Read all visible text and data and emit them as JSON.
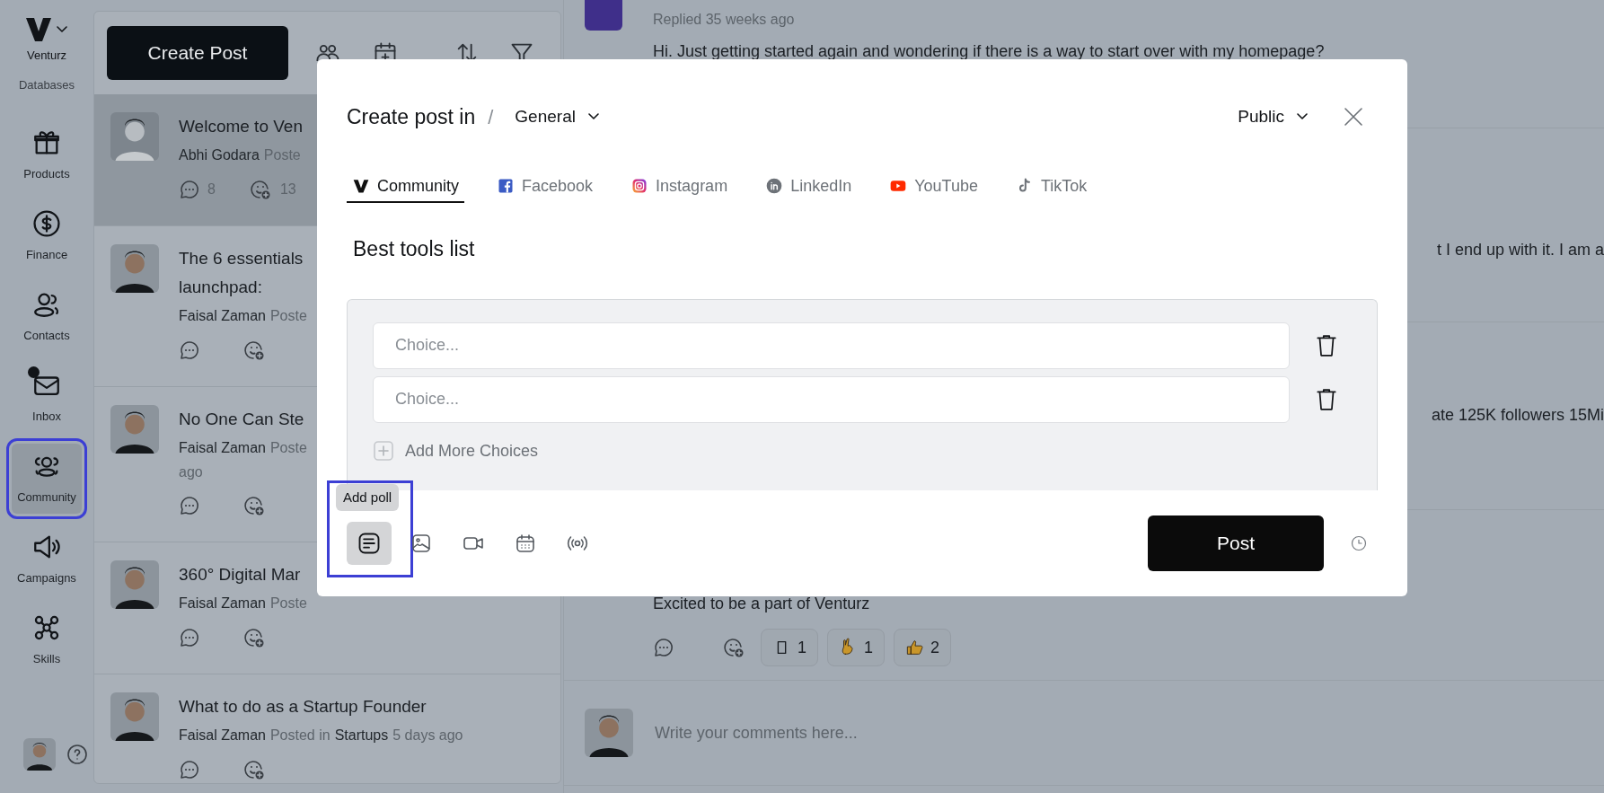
{
  "sidebar": {
    "brand": "Venturz",
    "items": [
      {
        "label": "Databases",
        "selected": false,
        "unread": false,
        "outlined": false
      },
      {
        "label": "Products",
        "selected": false,
        "unread": false,
        "outlined": false
      },
      {
        "label": "Finance",
        "selected": false,
        "unread": false,
        "outlined": false
      },
      {
        "label": "Contacts",
        "selected": false,
        "unread": false,
        "outlined": false
      },
      {
        "label": "Inbox",
        "selected": false,
        "unread": true,
        "outlined": false
      },
      {
        "label": "Community",
        "selected": true,
        "unread": false,
        "outlined": true
      },
      {
        "label": "Campaigns",
        "selected": false,
        "unread": false,
        "outlined": false
      },
      {
        "label": "Skills",
        "selected": false,
        "unread": false,
        "outlined": false
      }
    ]
  },
  "feed": {
    "create_button": "Create Post",
    "posts": [
      {
        "title_lines": [
          "Welcome to Ven"
        ],
        "author": "Abhi Godara",
        "meta_lines": [
          "Poste"
        ],
        "comments": "8",
        "reactions": "13",
        "selected": true
      },
      {
        "title_lines": [
          "The 6 essentials",
          "launchpad:"
        ],
        "author": "Faisal Zaman",
        "meta_lines": [
          "Poste"
        ],
        "selected": false
      },
      {
        "title_lines": [
          "No One Can Ste"
        ],
        "author": "Faisal Zaman",
        "meta_lines": [
          "Poste",
          "ago"
        ],
        "selected": false
      },
      {
        "title_lines": [
          "360° Digital Mar"
        ],
        "author": "Faisal Zaman",
        "meta_lines": [
          "Poste"
        ],
        "selected": false
      },
      {
        "title_lines": [
          "What to do as a Startup Founder"
        ],
        "author": "Faisal Zaman",
        "meta_lines": [
          "Posted in"
        ],
        "channel": "Startups",
        "time": "5 days ago",
        "selected": false
      }
    ]
  },
  "thread": {
    "reply_meta": "Replied 35 weeks ago",
    "reply_text": "Hi. Just getting started again and wondering if there is a way to start over with my homepage?",
    "fragments": [
      "t I end up with it. I am a",
      "ate 125K followers 15Mi"
    ],
    "post_text": "Excited to be a part of Venturz",
    "reactions": [
      {
        "count": "1"
      },
      {
        "count": "1"
      },
      {
        "count": "2"
      }
    ],
    "comment_placeholder": "Write your comments here..."
  },
  "modal": {
    "title": "Create post in",
    "separator": "/",
    "group": "General",
    "visibility": "Public",
    "tabs": [
      {
        "label": "Community",
        "selected": true
      },
      {
        "label": "Facebook",
        "selected": false
      },
      {
        "label": "Instagram",
        "selected": false
      },
      {
        "label": "LinkedIn",
        "selected": false
      },
      {
        "label": "YouTube",
        "selected": false
      },
      {
        "label": "TikTok",
        "selected": false
      }
    ],
    "post_title": "Best tools list",
    "poll": {
      "choices": [
        {
          "placeholder": "Choice..."
        },
        {
          "placeholder": "Choice..."
        }
      ],
      "add_more": "Add More Choices"
    },
    "toolbar": [
      {
        "selected": true,
        "tooltip": "Add poll",
        "outlined": true
      },
      {
        "selected": false,
        "outlined": false
      },
      {
        "selected": false,
        "outlined": false
      },
      {
        "selected": false,
        "outlined": false
      },
      {
        "selected": false,
        "outlined": false
      }
    ],
    "post_button": "Post"
  }
}
